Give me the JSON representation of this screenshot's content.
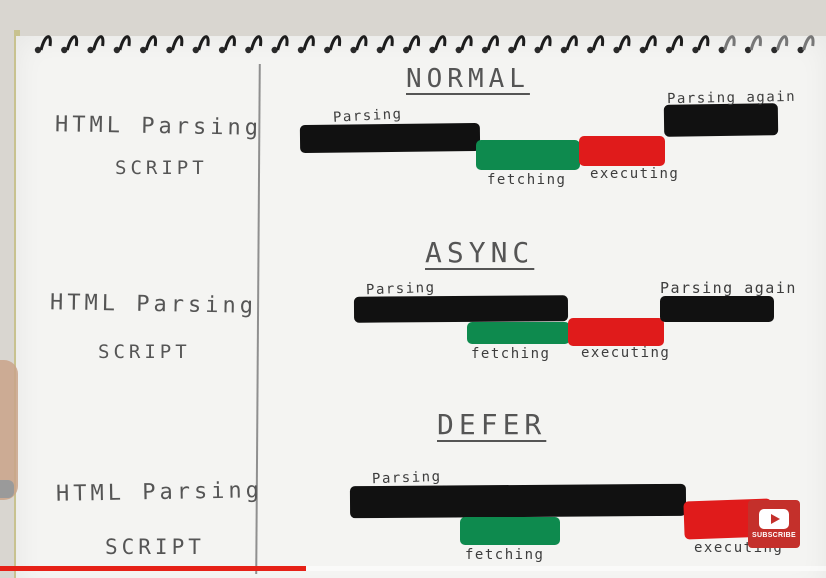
{
  "left_labels": {
    "html_parsing": "HTML Parsing",
    "script": "SCRIPT"
  },
  "sections": {
    "normal": {
      "heading": "NORMAL",
      "parsing": "Parsing",
      "fetching": "fetching",
      "executing": "executing",
      "parsing_again": "Parsing again"
    },
    "async": {
      "heading": "ASYNC",
      "parsing": "Parsing",
      "fetching": "fetching",
      "executing": "executing",
      "parsing_again": "Parsing again"
    },
    "defer": {
      "heading": "DEFER",
      "parsing": "Parsing",
      "fetching": "fetching",
      "executing": "executing"
    }
  },
  "colors": {
    "parsing": "#111111",
    "fetching": "#0e8a4e",
    "executing": "#e01b1b"
  },
  "video_player": {
    "subscribe_label": "SUBSCRIBE",
    "progress": 0.37
  }
}
